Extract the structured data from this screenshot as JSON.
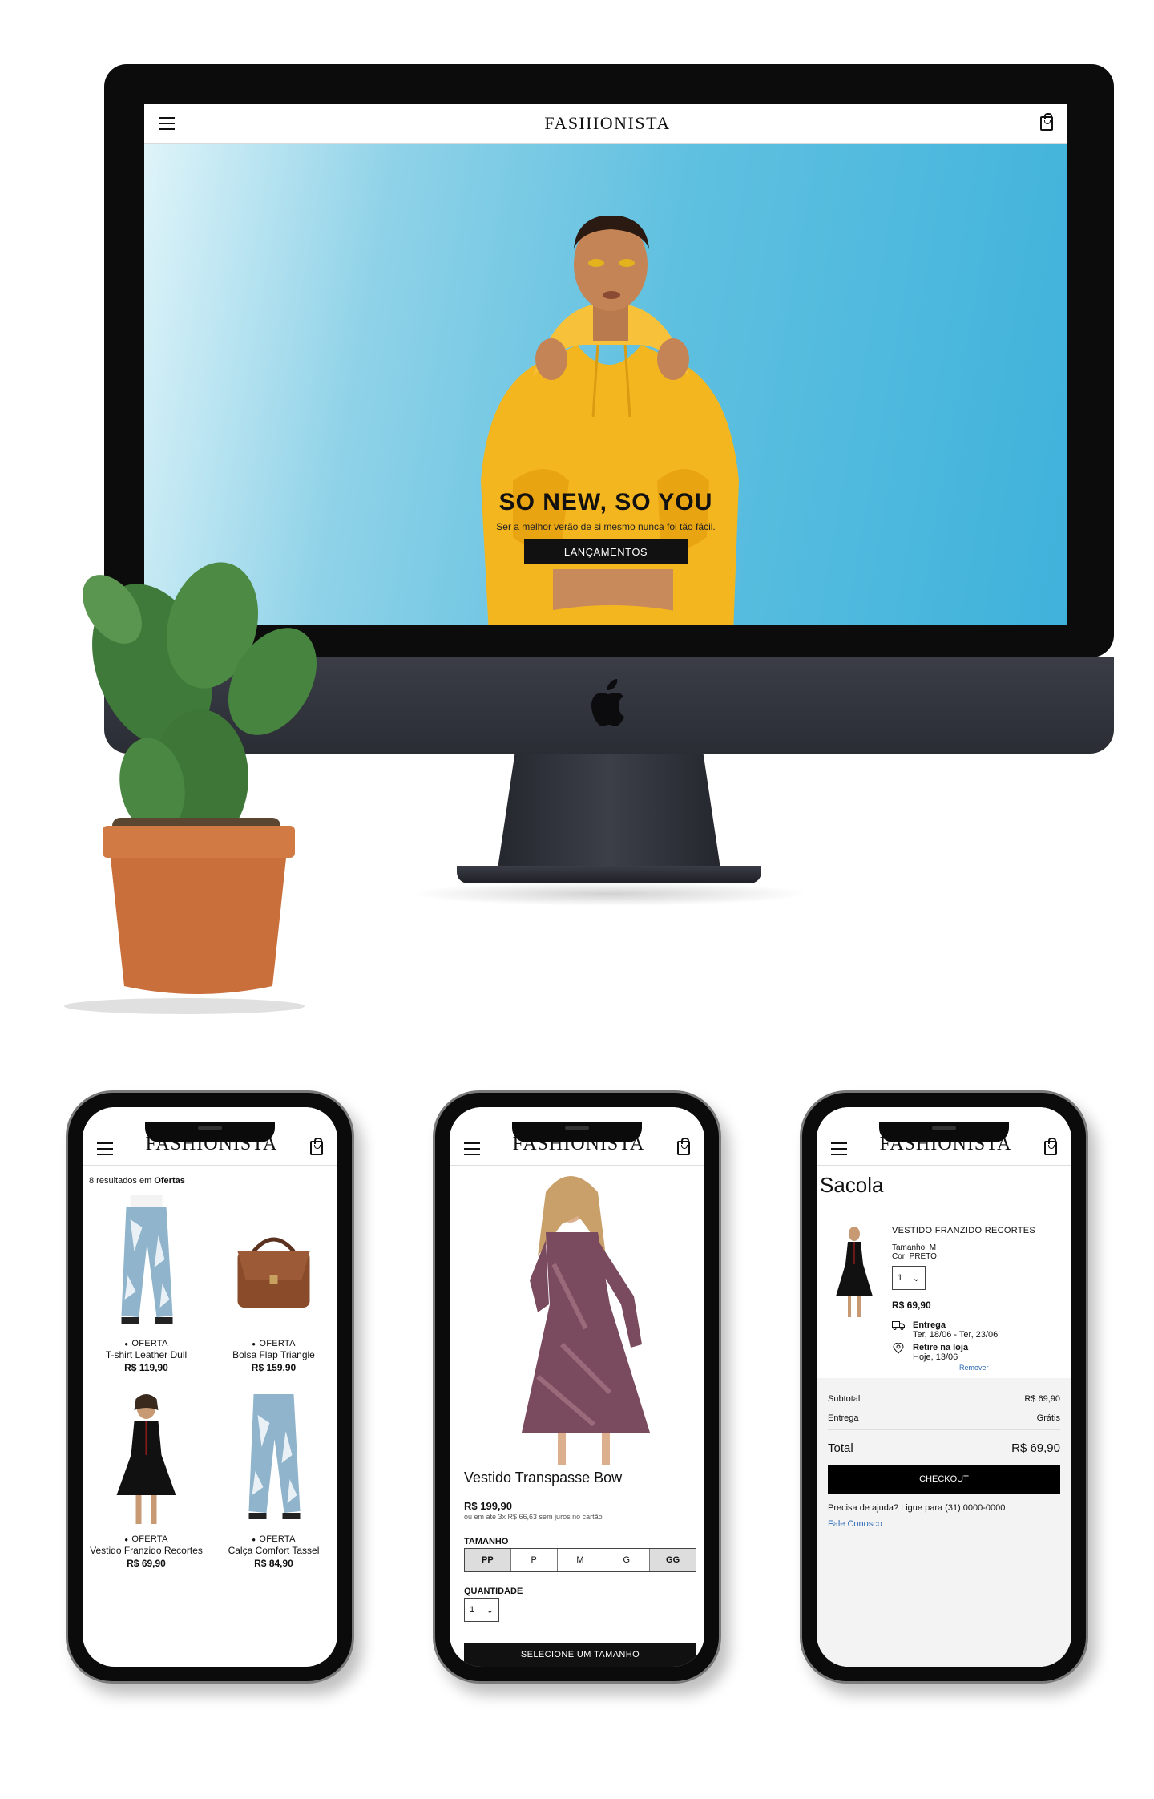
{
  "brand": "FASHIONISTA",
  "colors": {
    "accent": "#111111",
    "hero_sky": "#5fc0e0",
    "link": "#2d6bb5",
    "hoodie": "#f4b61f"
  },
  "desktop": {
    "hero": {
      "title": "SO NEW, SO YOU",
      "subtitle": "Ser a melhor verão de si mesmo nunca foi tão fácil.",
      "button": "LANÇAMENTOS"
    }
  },
  "catalog": {
    "results_prefix": "8 resultados em",
    "results_category": "Ofertas",
    "products": [
      {
        "tag": "OFERTA",
        "name": "T-shirt Leather Dull",
        "price": "R$ 119,90"
      },
      {
        "tag": "OFERTA",
        "name": "Bolsa Flap Triangle",
        "price": "R$ 159,90"
      },
      {
        "tag": "OFERTA",
        "name": "Vestido Franzido Recortes",
        "price": "R$ 69,90"
      },
      {
        "tag": "OFERTA",
        "name": "Calça Comfort Tassel",
        "price": "R$ 84,90"
      }
    ]
  },
  "product": {
    "name": "Vestido Transpasse Bow",
    "price": "R$ 199,90",
    "installments": "ou em até 3x R$ 66,63 sem juros no cartão",
    "size_label": "TAMANHO",
    "sizes": [
      "PP",
      "P",
      "M",
      "G",
      "GG"
    ],
    "qty_label": "QUANTIDADE",
    "qty_value": "1",
    "button": "SELECIONE UM TAMANHO"
  },
  "cart": {
    "title": "Sacola",
    "item": {
      "name": "VESTIDO FRANZIDO RECORTES",
      "size": "Tamanho: M",
      "color": "Cor: PRETO",
      "qty": "1",
      "price": "R$ 69,90",
      "delivery_label": "Entrega",
      "delivery_date": "Ter, 18/06 - Ter, 23/06",
      "pickup_label": "Retire na loja",
      "pickup_date": "Hoje, 13/06",
      "remove": "Remover"
    },
    "subtotal_label": "Subtotal",
    "subtotal_value": "R$ 69,90",
    "shipping_label": "Entrega",
    "shipping_value": "Grátis",
    "total_label": "Total",
    "total_value": "R$ 69,90",
    "checkout": "CHECKOUT",
    "help": "Precisa de ajuda? Ligue para (31) 0000-0000",
    "contact": "Fale Conosco"
  }
}
